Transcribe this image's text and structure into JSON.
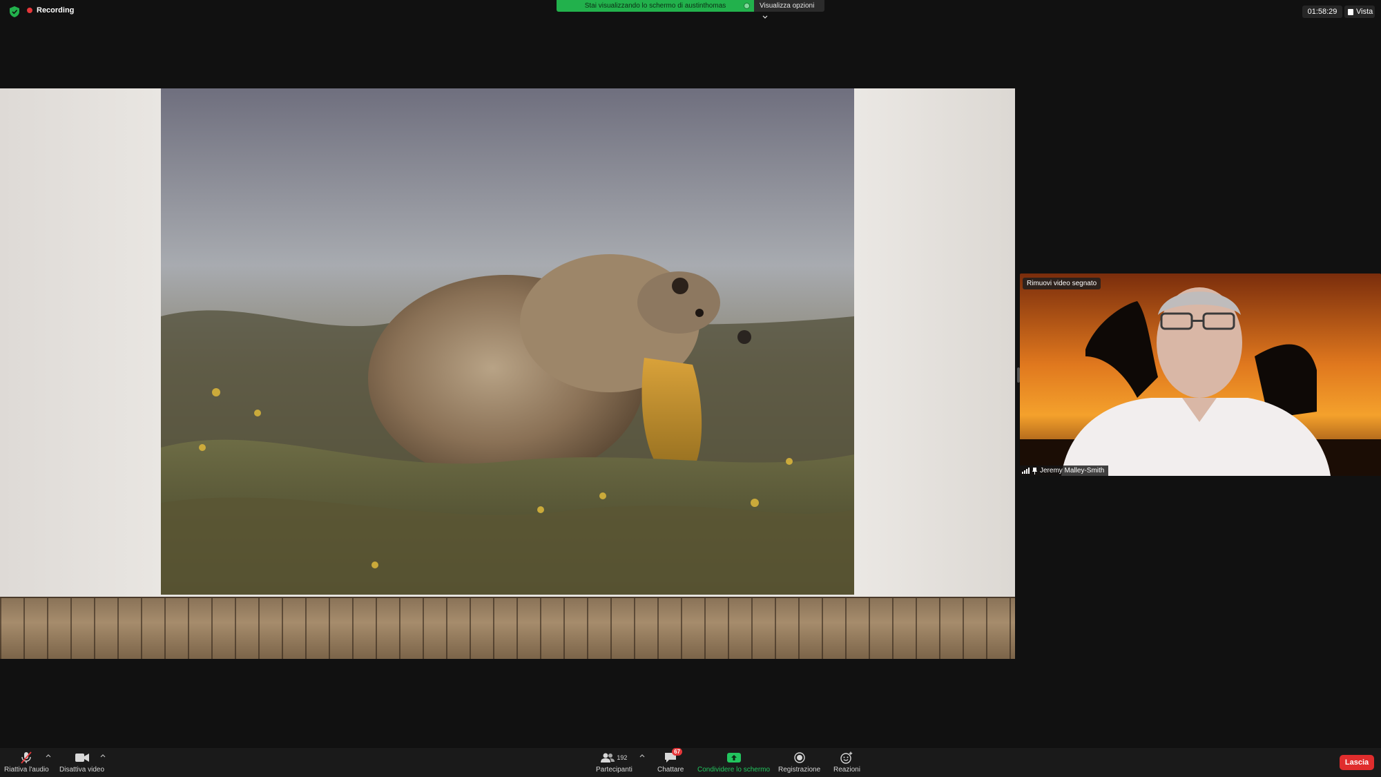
{
  "topbar": {
    "recording_label": "Recording",
    "share_banner_text": "Stai visualizzando lo schermo di austinthomas",
    "view_options_label": "Visualizza opzioni",
    "meeting_time": "01:58:29",
    "view_label": "Vista"
  },
  "video": {
    "unpin_label": "Rimuovi video segnato",
    "participant_name": "Jeremy Malley-Smith"
  },
  "toolbar": {
    "unmute_label": "Riattiva l'audio",
    "stop_video_label": "Disattiva video",
    "participants_label": "Partecipanti",
    "participants_count": "192",
    "chat_label": "Chattare",
    "chat_badge": "67",
    "share_screen_label": "Condividere lo schermo",
    "record_label": "Registrazione",
    "reactions_label": "Reazioni",
    "leave_label": "Lascia"
  },
  "colors": {
    "background": "#111111",
    "recording_red": "#e5373a",
    "share_green": "#22b14c",
    "leave_red": "#e02d2d"
  },
  "icons": [
    "shield-icon",
    "recording-dot-icon",
    "chevron-down-icon",
    "layout-icon",
    "muted-mic-icon",
    "video-camera-icon",
    "participants-icon",
    "chat-icon",
    "share-screen-icon",
    "record-icon",
    "reactions-icon",
    "signal-icon",
    "pin-icon"
  ]
}
